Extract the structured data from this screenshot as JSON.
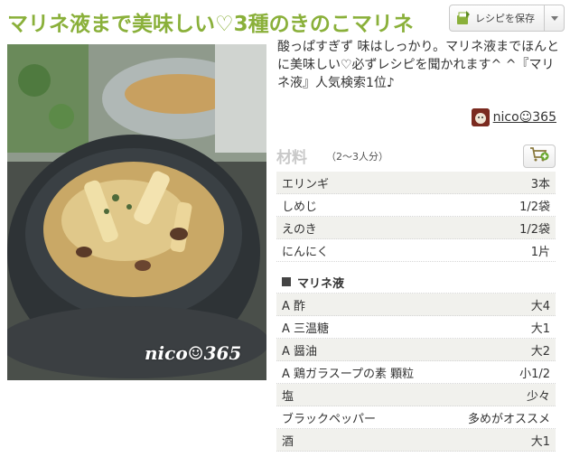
{
  "title": "マリネ液まで美味しい♡3種のきのこマリネ",
  "save_button": {
    "label": "レシピを保存",
    "icon": "save-icon"
  },
  "photo": {
    "watermark": "nico☺365"
  },
  "description": "酸っぱすぎず 味はしっかり。マリネ液までほんとに美味しい♡必ずレシピを聞かれます^ ^『マリネ液』人気検索1位♪",
  "author": {
    "name": "nico☺365"
  },
  "ingredients": {
    "title": "材料",
    "serving": "（2〜3人分）",
    "main": [
      {
        "name": "エリンギ",
        "amount": "3本"
      },
      {
        "name": "しめじ",
        "amount": "1/2袋"
      },
      {
        "name": "えのき",
        "amount": "1/2袋"
      },
      {
        "name": "にんにく",
        "amount": "1片"
      }
    ],
    "section_title": "マリネ液",
    "marinade": [
      {
        "name": "A 酢",
        "amount": "大4"
      },
      {
        "name": "A 三温糖",
        "amount": "大1"
      },
      {
        "name": "A 醤油",
        "amount": "大2"
      },
      {
        "name": "A 鶏ガラスープの素 顆粒",
        "amount": "小1/2"
      },
      {
        "name": "塩",
        "amount": "少々"
      },
      {
        "name": "ブラックペッパー",
        "amount": "多めがオススメ"
      },
      {
        "name": "酒",
        "amount": "大1"
      }
    ]
  },
  "colors": {
    "title": "#8ab03a",
    "shade": "#f1f1ed"
  }
}
